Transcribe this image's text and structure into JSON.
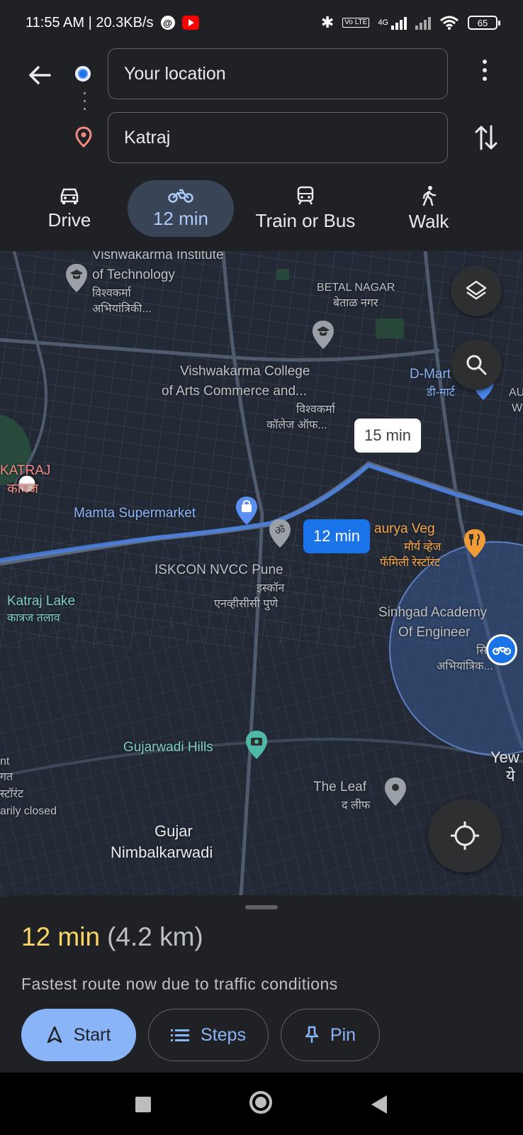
{
  "status_bar": {
    "time_speed": "11:55 AM | 20.3KB/s",
    "network": "4G",
    "lte": "Vo LTE",
    "battery": "65"
  },
  "directions": {
    "origin": "Your location",
    "destination": "Katraj"
  },
  "modes": [
    {
      "label": "Drive",
      "icon": "car-icon"
    },
    {
      "label": "12 min",
      "icon": "motorcycle-icon",
      "active": true
    },
    {
      "label": "Train or Bus",
      "icon": "train-icon"
    },
    {
      "label": "Walk",
      "icon": "walk-icon"
    }
  ],
  "map": {
    "labels": {
      "vit": "Vishwakarma Institute",
      "vit2": "of Technology",
      "vit3": "विश्वकर्मा",
      "vit4": "अभियांत्रिकी...",
      "betal": "BETAL NAGAR",
      "betal2": "बेताळ नगर",
      "vcol": "Vishwakarma College",
      "vcol2": "of Arts Commerce and...",
      "vcol3": "विश्वकर्मा",
      "vcol4": "कॉलेज ऑफ...",
      "dmart": "D-Mart",
      "dmart2": "डी-मार्ट",
      "au": "AU",
      "w": "W",
      "katraj": "KATRAJ",
      "katraj2": "कात्रज",
      "mamta": "Mamta Supermarket",
      "maurya": "aurya Veg",
      "maurya2": "मौर्य व्हेज",
      "maurya3": "फॅमिली रेस्टॉरंट",
      "iskcon": "ISKCON NVCC Pune",
      "iskcon2": "इस्कॉन",
      "iskcon3": "एनव्हीसीसी पुणे",
      "lake": "Katraj Lake",
      "lake2": "कात्रज तलाव",
      "sinhgad": "Sinhgad Academy",
      "sinhgad2": "Of Engineer",
      "sinhgad3": "सि",
      "sinhgad4": "अभियांत्रिक...",
      "gujar_hills": "Gujarwadi Hills",
      "yew": "Yew",
      "yew2": "ये",
      "leaf": "The Leaf",
      "leaf2": "द लीफ",
      "left1": "nt",
      "left2": "गत",
      "left3": "स्टॉरंट",
      "left4": "arily closed",
      "gujar": "Gujar",
      "nimbal": "Nimbalkarwadi"
    },
    "callout_alt": "15 min",
    "callout_main": "12 min"
  },
  "summary": {
    "time": "12 min",
    "distance": "(4.2 km)",
    "note": "Fastest route now due to traffic conditions",
    "start": "Start",
    "steps": "Steps",
    "pin": "Pin"
  },
  "colors": {
    "accent": "#8ab4f8",
    "route": "#1a73e8",
    "eta": "#fdd663"
  }
}
